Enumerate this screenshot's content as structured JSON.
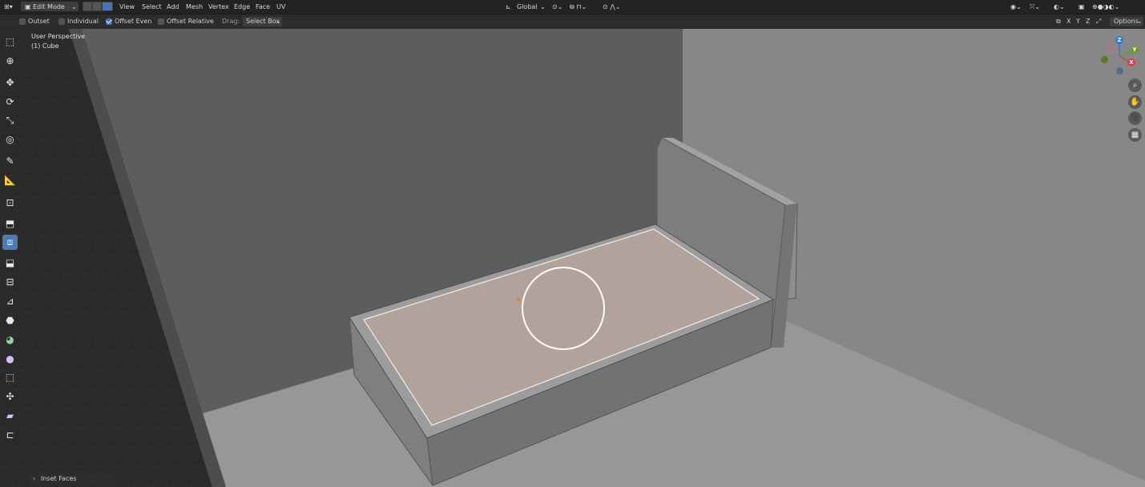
{
  "header": {
    "mode_label": "Edit Mode",
    "menus": [
      "View",
      "Select",
      "Add",
      "Mesh",
      "Vertex",
      "Edge",
      "Face",
      "UV"
    ],
    "orientation_label": "Global"
  },
  "tool_settings": {
    "outset": {
      "label": "Outset",
      "checked": false
    },
    "individual": {
      "label": "Individual",
      "checked": false
    },
    "offset_even": {
      "label": "Offset Even",
      "checked": true
    },
    "offset_relative": {
      "label": "Offset Relative",
      "checked": false
    },
    "drag_label": "Drag:",
    "drag_value": "Select Box",
    "axis_labels": [
      "X",
      "Y",
      "Z"
    ],
    "options_label": "Options"
  },
  "viewport": {
    "perspective_label": "User Perspective",
    "object_label": "(1) Cube"
  },
  "gizmo": {
    "z": "Z",
    "y": "Y",
    "x": "X"
  },
  "operator_panel": {
    "label": "Inset Faces"
  },
  "toolbar_icons": [
    "select-box-icon",
    "cursor-icon",
    "move-icon",
    "rotate-icon",
    "scale-icon",
    "transform-icon",
    "annotate-icon",
    "measure-icon",
    "add-cube-icon",
    "extrude-icon",
    "inset-faces-icon",
    "bevel-icon",
    "loop-cut-icon",
    "knife-icon",
    "poly-build-icon",
    "spin-icon",
    "smooth-icon",
    "edge-slide-icon",
    "shrink-fatten-icon",
    "shear-icon",
    "rip-region-icon"
  ],
  "colors": {
    "accent": "#4772b3",
    "selected_face": "#b1a39b",
    "header_bg": "#232323"
  }
}
